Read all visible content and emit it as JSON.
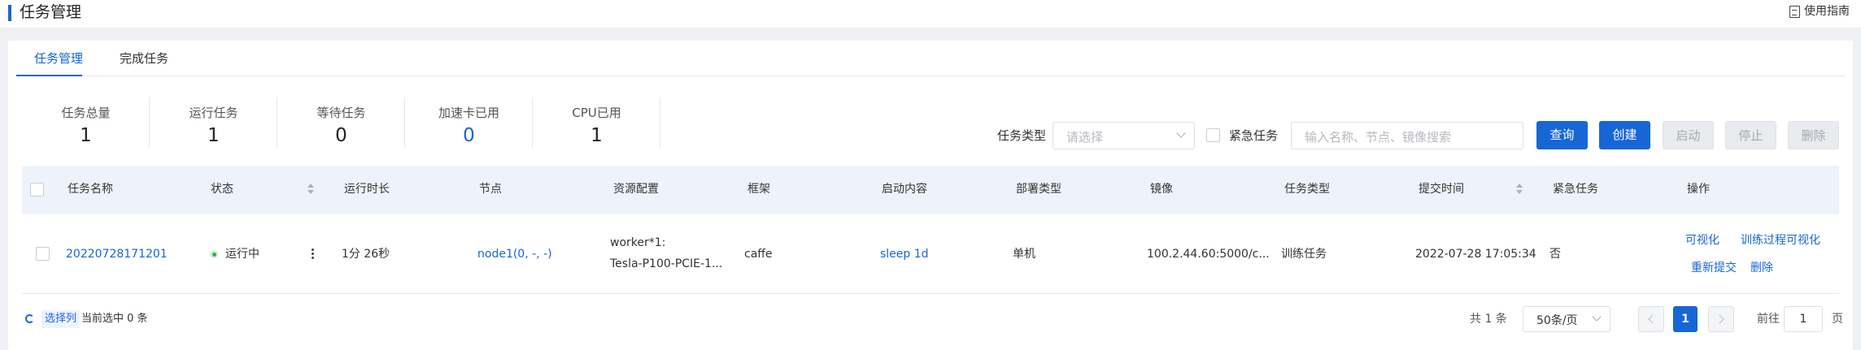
{
  "header": {
    "title": "任务管理",
    "guide_label": "使用指南"
  },
  "tabs": [
    {
      "label": "任务管理",
      "active": true
    },
    {
      "label": "完成任务",
      "active": false
    }
  ],
  "stats": [
    {
      "label": "任务总量",
      "value": "1"
    },
    {
      "label": "运行任务",
      "value": "1"
    },
    {
      "label": "等待任务",
      "value": "0"
    },
    {
      "label": "加速卡已用",
      "value": "0"
    },
    {
      "label": "CPU已用",
      "value": "1"
    }
  ],
  "filters": {
    "task_type_label": "任务类型",
    "task_type_placeholder": "请选择",
    "urgent_label": "紧急任务",
    "search_placeholder": "输入名称、节点、镜像搜索"
  },
  "buttons": {
    "query": "查询",
    "create": "创建",
    "start": "启动",
    "stop": "停止",
    "delete": "删除"
  },
  "table": {
    "columns": [
      "任务名称",
      "状态",
      "运行时长",
      "节点",
      "资源配置",
      "框架",
      "启动内容",
      "部署类型",
      "镜像",
      "任务类型",
      "提交时间",
      "紧急任务",
      "操作"
    ],
    "rows": [
      {
        "name": "20220728171201",
        "status": "运行中",
        "duration": "1分 26秒",
        "node": "node1(0, -, -)",
        "resource_line1": "worker*1:",
        "resource_line2": "Tesla-P100-PCIE-1...",
        "framework": "caffe",
        "start_content": "sleep 1d",
        "deploy_type": "单机",
        "image": "100.2.44.60:5000/c...",
        "task_type": "训练任务",
        "submit_time": "2022-07-28 17:05:34",
        "urgent": "否",
        "actions": [
          "可视化",
          "训练过程可视化",
          "重新提交",
          "删除"
        ]
      }
    ]
  },
  "footer": {
    "select_columns": "选择列",
    "selected_info": "当前选中 0 条",
    "total": "共 1 条",
    "page_size": "50条/页",
    "current_page": "1",
    "goto_prefix": "前往",
    "goto_value": "1",
    "goto_suffix": "页"
  },
  "colors": {
    "accent": "#1766d6",
    "status_running": "#3fae49"
  }
}
